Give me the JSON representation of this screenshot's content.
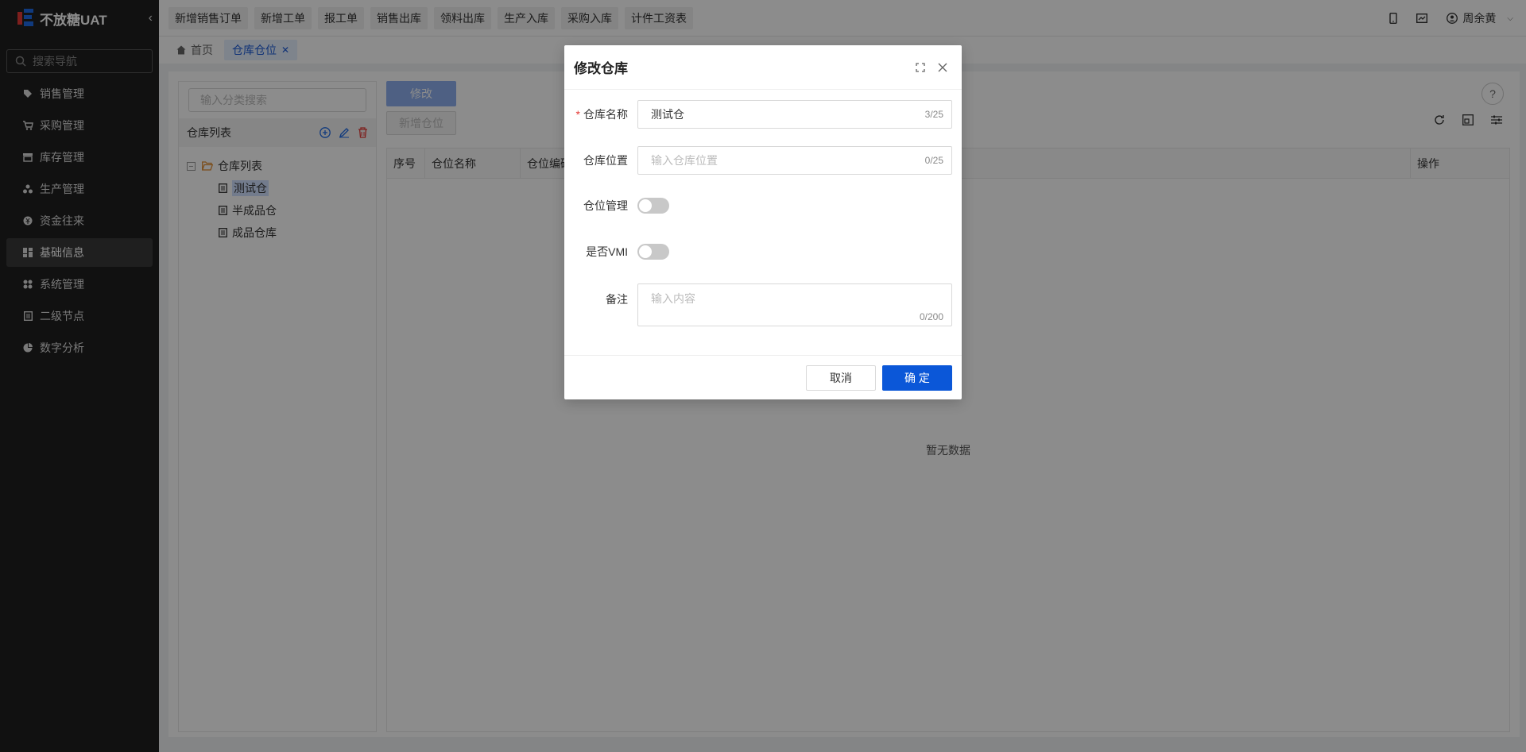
{
  "app": {
    "title": "不放糖UAT"
  },
  "sidebar": {
    "search_placeholder": "搜索导航",
    "items": [
      {
        "label": "销售管理",
        "icon": "tag-icon"
      },
      {
        "label": "采购管理",
        "icon": "cart-icon"
      },
      {
        "label": "库存管理",
        "icon": "warehouse-icon"
      },
      {
        "label": "生产管理",
        "icon": "production-icon"
      },
      {
        "label": "资金往来",
        "icon": "money-icon"
      },
      {
        "label": "基础信息",
        "icon": "dashboard-icon",
        "active": true
      },
      {
        "label": "系统管理",
        "icon": "apps-icon"
      },
      {
        "label": "二级节点",
        "icon": "document-icon"
      },
      {
        "label": "数字分析",
        "icon": "pie-chart-icon"
      }
    ]
  },
  "topbar": {
    "quick_links": [
      "新增销售订单",
      "新增工单",
      "报工单",
      "销售出库",
      "领料出库",
      "生产入库",
      "采购入库",
      "计件工资表"
    ],
    "user_name": "周余黄"
  },
  "tabs": [
    {
      "label": "首页",
      "active": false
    },
    {
      "label": "仓库仓位",
      "active": true
    }
  ],
  "left_panel": {
    "search_placeholder": "输入分类搜索",
    "header": "仓库列表",
    "tree": {
      "root": "仓库列表",
      "children": [
        "测试仓",
        "半成品仓",
        "成品仓库"
      ]
    }
  },
  "right_panel": {
    "edit_button": "修改",
    "add_location_button": "新增仓位",
    "columns": [
      "序号",
      "仓位名称",
      "仓位编码",
      "操作"
    ],
    "empty_text": "暂无数据"
  },
  "modal": {
    "title": "修改仓库",
    "fields": {
      "name_label": "仓库名称",
      "name_value": "测试仓",
      "name_count": "3/25",
      "location_label": "仓库位置",
      "location_placeholder": "输入仓库位置",
      "location_count": "0/25",
      "slot_label": "仓位管理",
      "vmi_label": "是否VMI",
      "remark_label": "备注",
      "remark_placeholder": "输入内容",
      "remark_count": "0/200"
    },
    "cancel_label": "取消",
    "ok_label": "确 定"
  },
  "colors": {
    "primary": "#0b57d8",
    "sidebar_bg": "#1f1f1f",
    "required": "#e53935"
  }
}
